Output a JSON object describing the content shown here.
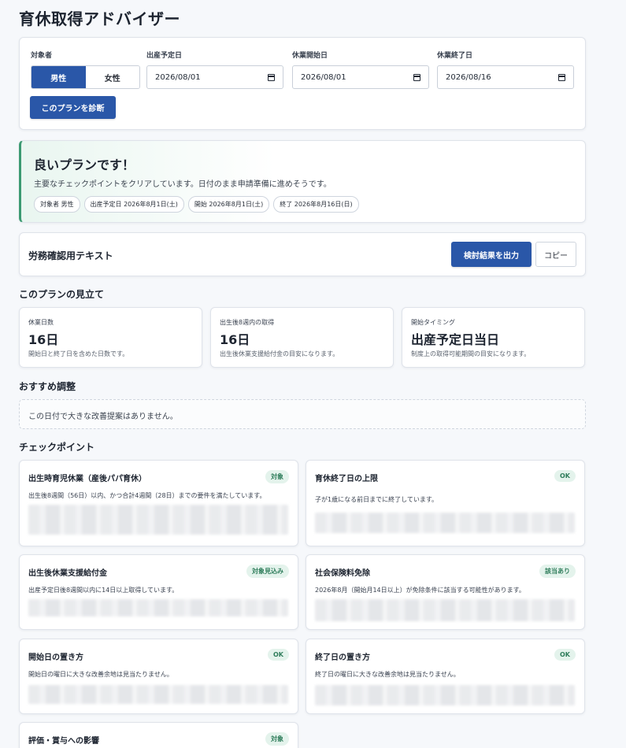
{
  "app": {
    "title": "育休取得アドバイザー"
  },
  "form": {
    "target_label": "対象者",
    "male": "男性",
    "female": "女性",
    "due_label": "出産予定日",
    "due_value": "2026/08/01",
    "start_label": "休業開始日",
    "start_value": "2026/08/01",
    "end_label": "休業終了日",
    "end_value": "2026/08/16",
    "diagnose_button": "このプランを診断"
  },
  "result": {
    "title": "良いプランです！",
    "description": "主要なチェックポイントをクリアしています。日付のまま申請準備に進めそうです。",
    "chips": [
      "対象者 男性",
      "出産予定日 2026年8月1日(土)",
      "開始 2026年8月1日(土)",
      "終了 2026年8月16日(日)"
    ],
    "accent_color": "#3c9a72"
  },
  "text_section": {
    "title": "労務確認用テキスト",
    "export_button": "検討結果を出力",
    "copy_button": "コピー"
  },
  "outlook": {
    "title": "このプランの見立て",
    "metrics": [
      {
        "label": "休業日数",
        "value": "16日",
        "note": "開始日と終了日を含めた日数です。"
      },
      {
        "label": "出生後8週内の取得",
        "value": "16日",
        "note": "出生後休業支援給付金の目安になります。"
      },
      {
        "label": "開始タイミング",
        "value": "出産予定日当日",
        "note": "制度上の取得可能期間の目安になります。"
      }
    ]
  },
  "suggestions": {
    "title": "おすすめ調整",
    "empty_text": "この日付で大きな改善提案はありません。"
  },
  "checkpoints": {
    "title": "チェックポイント",
    "items": [
      {
        "title": "出生時育児休業（産後パパ育休）",
        "badge": "対象",
        "desc": "出生後8週間（56日）以内、かつ合計4週間（28日）までの要件を満たしています。"
      },
      {
        "title": "育休終了日の上限",
        "badge": "OK",
        "desc": "子が1歳になる前日までに終了しています。"
      },
      {
        "title": "出生後休業支援給付金",
        "badge": "対象見込み",
        "desc": "出産予定日後8週間以内に14日以上取得しています。"
      },
      {
        "title": "社会保険料免除",
        "badge": "該当あり",
        "desc": "2026年8月（開始月14日以上）が免除条件に該当する可能性があります。"
      },
      {
        "title": "開始日の置き方",
        "badge": "OK",
        "desc": "開始日の曜日に大きな改善余地は見当たりません。"
      },
      {
        "title": "終了日の置き方",
        "badge": "OK",
        "desc": "終了日の曜日に大きな改善余地は見当たりません。"
      },
      {
        "title": "評価・賞与への影響",
        "badge": "対象",
        "desc": ""
      }
    ]
  },
  "colors": {
    "primary": "#2a57a8",
    "badge_text": "#2f7d5b",
    "badge_bg": "#e4f3ec"
  }
}
